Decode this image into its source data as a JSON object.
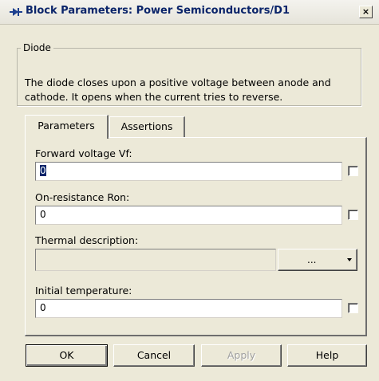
{
  "window": {
    "title": "Block Parameters: Power Semiconductors/D1",
    "close_glyph": "×"
  },
  "description_group": {
    "legend": "Diode",
    "text_line1": "The diode closes upon a positive voltage between anode and",
    "text_line2": "cathode. It opens when the current tries to reverse."
  },
  "tabs": [
    {
      "label": "Parameters",
      "active": true
    },
    {
      "label": "Assertions",
      "active": false
    }
  ],
  "params": {
    "forward_voltage": {
      "label": "Forward voltage Vf:",
      "value": "0",
      "checked": false
    },
    "on_resistance": {
      "label": "On-resistance Ron:",
      "value": "0",
      "checked": false
    },
    "thermal": {
      "label": "Thermal description:",
      "value": "",
      "combo_value": "..."
    },
    "initial_temperature": {
      "label": "Initial temperature:",
      "value": "0",
      "checked": false
    }
  },
  "buttons": {
    "ok": "OK",
    "cancel": "Cancel",
    "apply": "Apply",
    "help": "Help"
  },
  "icons": {
    "app_icon": "block-diagram-icon",
    "dropdown_icon": "chevron-down-icon"
  }
}
